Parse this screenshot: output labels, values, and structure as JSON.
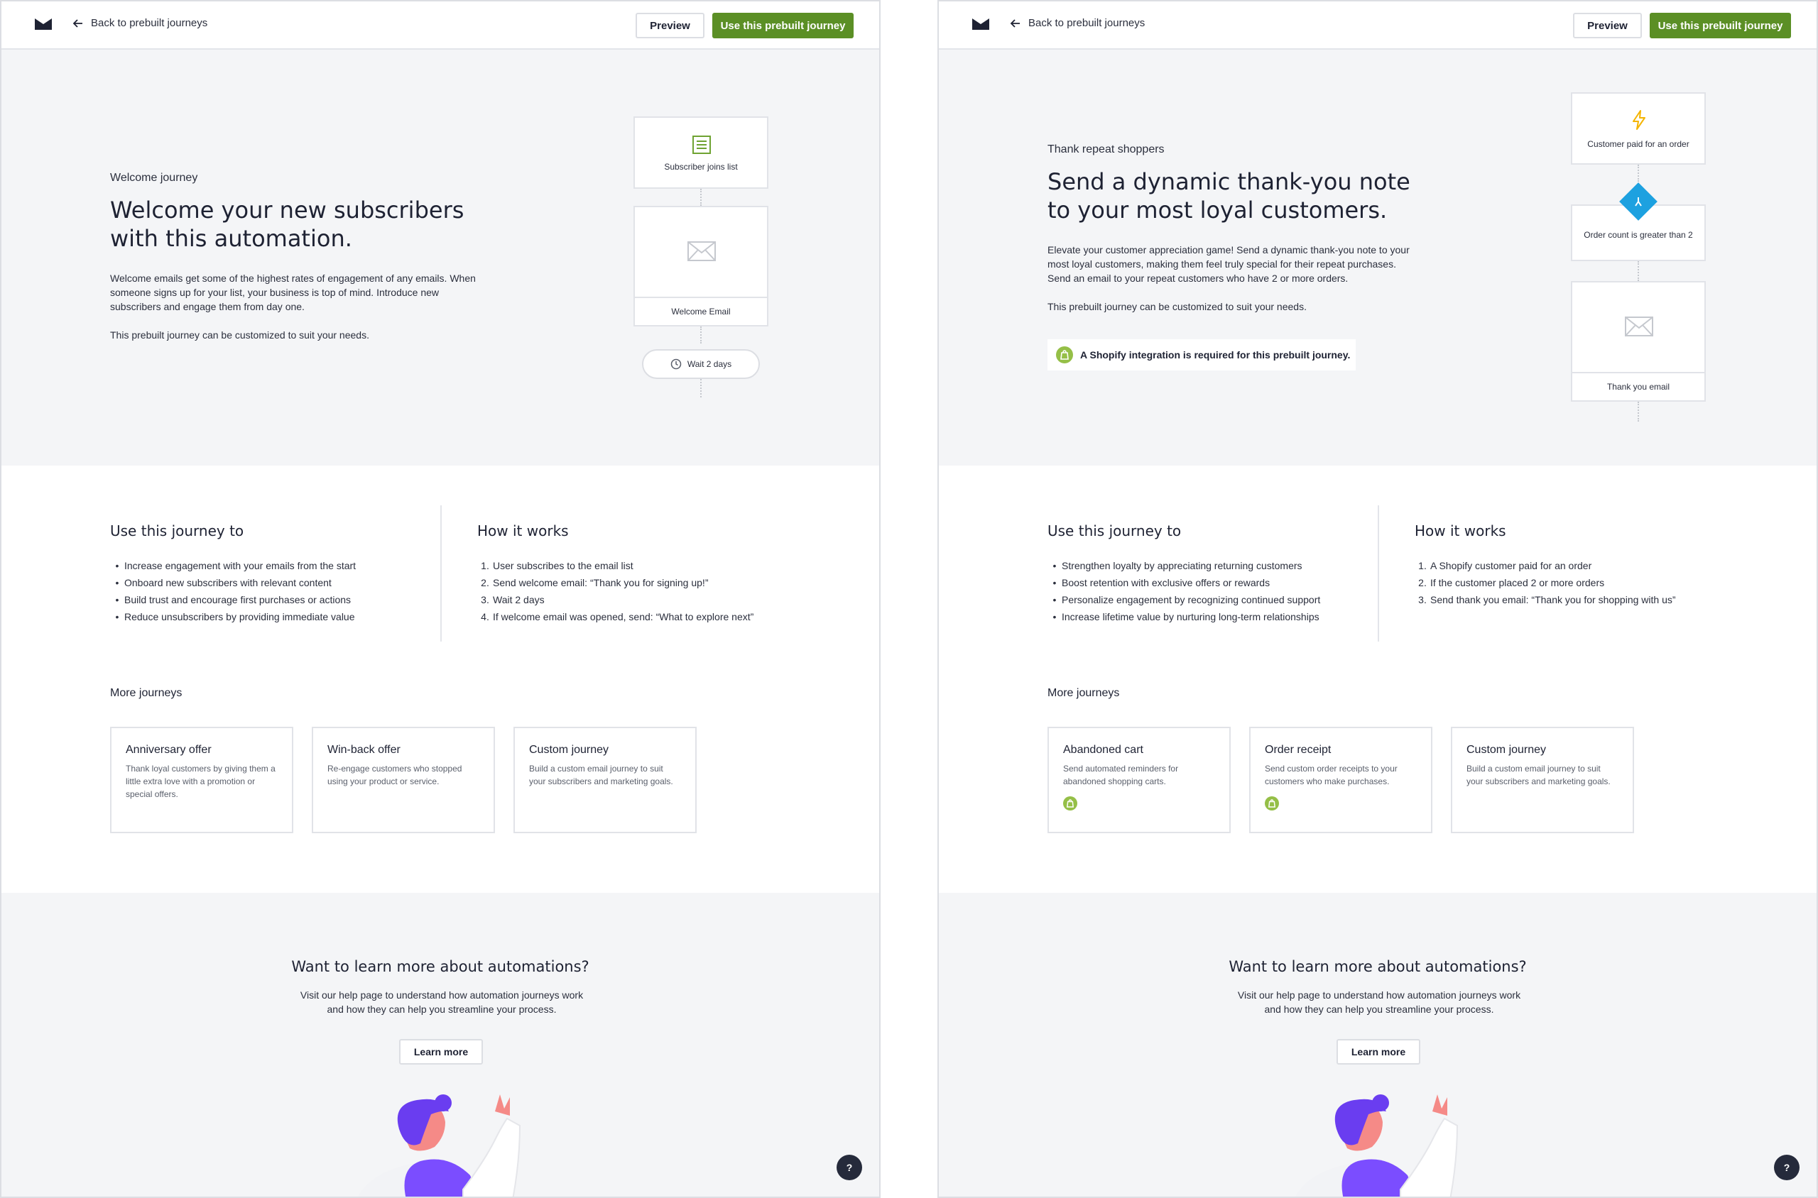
{
  "colors": {
    "accent_green": "#5b8f25",
    "shopify_green": "#95bf47",
    "condition_blue": "#1da1e0",
    "trigger_yellow": "#f4b400"
  },
  "pages": [
    {
      "back_label": "Back to prebuilt journeys",
      "preview_label": "Preview",
      "use_label": "Use this prebuilt journey",
      "eyebrow": "Welcome journey",
      "headline": "Welcome your new subscribers with this automation.",
      "body": [
        "Welcome emails get some of the highest rates of engagement of any emails. When someone signs up for your list, your business is top of mind. Introduce new subscribers and engage them from day one.",
        "This prebuilt journey can be customized to suit your needs."
      ],
      "flow": {
        "trigger": {
          "label": "Subscriber joins list",
          "icon": "list-icon"
        },
        "email": {
          "label": "Welcome Email",
          "icon": "envelope-icon"
        },
        "wait": {
          "label": "Wait 2 days",
          "icon": "clock-icon"
        }
      },
      "use_heading": "Use this journey to",
      "use_items": [
        "Increase engagement with your emails from the start",
        "Onboard new subscribers with relevant content",
        "Build trust and encourage first purchases or actions",
        "Reduce unsubscribers by providing immediate value"
      ],
      "how_heading": "How it works",
      "how_items": [
        {
          "n": "1.",
          "text": "User subscribes to the email list"
        },
        {
          "n": "2.",
          "text": "Send welcome email: “Thank you for signing up!”"
        },
        {
          "n": "3.",
          "text": "Wait 2 days"
        },
        {
          "n": "4.",
          "text": "If welcome email was opened, send: “What to explore next”"
        }
      ],
      "more_heading": "More journeys",
      "cards": [
        {
          "title": "Anniversary offer",
          "desc": "Thank loyal customers by giving them a little extra love with a promotion or special offers."
        },
        {
          "title": "Win-back offer",
          "desc": "Re-engage customers who stopped using your product or service."
        },
        {
          "title": "Custom journey",
          "desc": "Build a custom email journey to suit your subscribers and marketing goals."
        }
      ],
      "footer_title": "Want to learn more about automations?",
      "footer_desc": "Visit our help page to understand how automation journeys work and how they can help you streamline your process.",
      "learn_label": "Learn more",
      "help_label": "?"
    },
    {
      "back_label": "Back to prebuilt journeys",
      "preview_label": "Preview",
      "use_label": "Use this prebuilt journey",
      "eyebrow": "Thank repeat shoppers",
      "headline": "Send a dynamic thank-you note to your most loyal customers.",
      "body": [
        "Elevate your customer appreciation game! Send a dynamic thank-you note to your most loyal customers, making them feel truly special for their repeat purchases. Send an email to your repeat customers who have 2 or more orders.",
        "This prebuilt journey can be customized to suit your needs."
      ],
      "shopify_note": "A Shopify integration is required for this prebuilt journey.",
      "flow": {
        "trigger": {
          "label": "Customer paid for an order",
          "icon": "lightning-icon"
        },
        "condition": {
          "label": "Order count is greater than 2",
          "icon": "branch-icon"
        },
        "email": {
          "label": "Thank you email",
          "icon": "envelope-icon"
        }
      },
      "use_heading": "Use this journey to",
      "use_items": [
        "Strengthen loyalty by appreciating returning customers",
        "Boost retention with exclusive offers or rewards",
        "Personalize engagement by recognizing continued support",
        "Increase lifetime value by nurturing long-term relationships"
      ],
      "how_heading": "How it works",
      "how_items": [
        {
          "n": "1.",
          "text": "A Shopify customer paid for an order"
        },
        {
          "n": "2.",
          "text": "If the customer placed 2 or more orders"
        },
        {
          "n": "3.",
          "text": "Send thank you email: “Thank you for shopping with us”"
        }
      ],
      "more_heading": "More journeys",
      "cards": [
        {
          "title": "Abandoned cart",
          "desc": "Send automated reminders for abandoned shopping carts.",
          "icon": "shopify-icon"
        },
        {
          "title": "Order receipt",
          "desc": "Send custom order receipts to your customers who make purchases.",
          "icon": "shopify-icon"
        },
        {
          "title": "Custom journey",
          "desc": "Build a custom email journey to suit your subscribers and marketing goals."
        }
      ],
      "footer_title": "Want to learn more about automations?",
      "footer_desc": "Visit our help page to understand how automation journeys work and how they can help you streamline your process.",
      "learn_label": "Learn more",
      "help_label": "?"
    }
  ]
}
